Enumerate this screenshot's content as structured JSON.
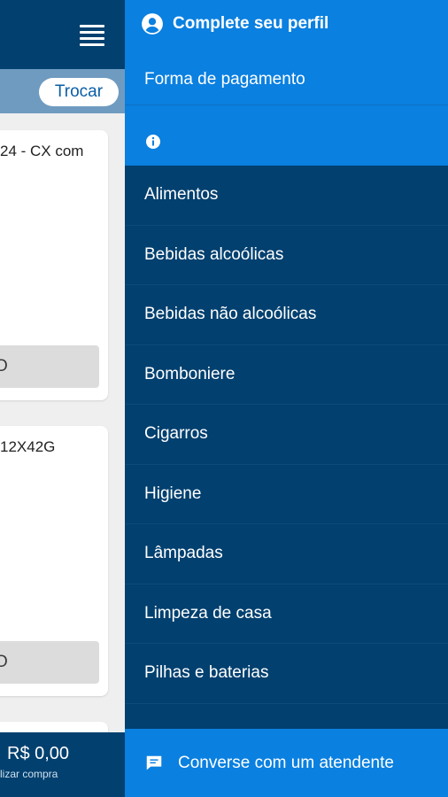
{
  "background": {
    "header": {
      "menu_icon": "hamburger-menu-icon"
    },
    "subbar": {
      "change_button_label": "Trocar"
    },
    "products": [
      {
        "title_fragment": "24 - CX com",
        "button_fragment": "O"
      },
      {
        "title_fragment": " 12X42G",
        "button_fragment": "O"
      }
    ],
    "cart": {
      "total": "R$ 0,00",
      "subtitle_fragment": "lizar compra"
    }
  },
  "drawer": {
    "profile": {
      "icon": "user-circle-icon",
      "label": "Complete seu perfil"
    },
    "payment_label": "Forma de pagamento",
    "info_icon": "info-icon",
    "categories": [
      "Alimentos",
      "Bebidas alcoólicas",
      "Bebidas não alcoólicas",
      "Bomboniere",
      "Cigarros",
      "Higiene",
      "Lâmpadas",
      "Limpeza de casa",
      "Pilhas e baterias"
    ],
    "chat": {
      "icon": "chat-bubble-icon",
      "label": "Converse com um atendente"
    }
  },
  "colors": {
    "primary_dark": "#02406f",
    "primary_bright": "#0a80e0",
    "subbar": "#6f9bc0",
    "page_bg": "#efefef"
  }
}
